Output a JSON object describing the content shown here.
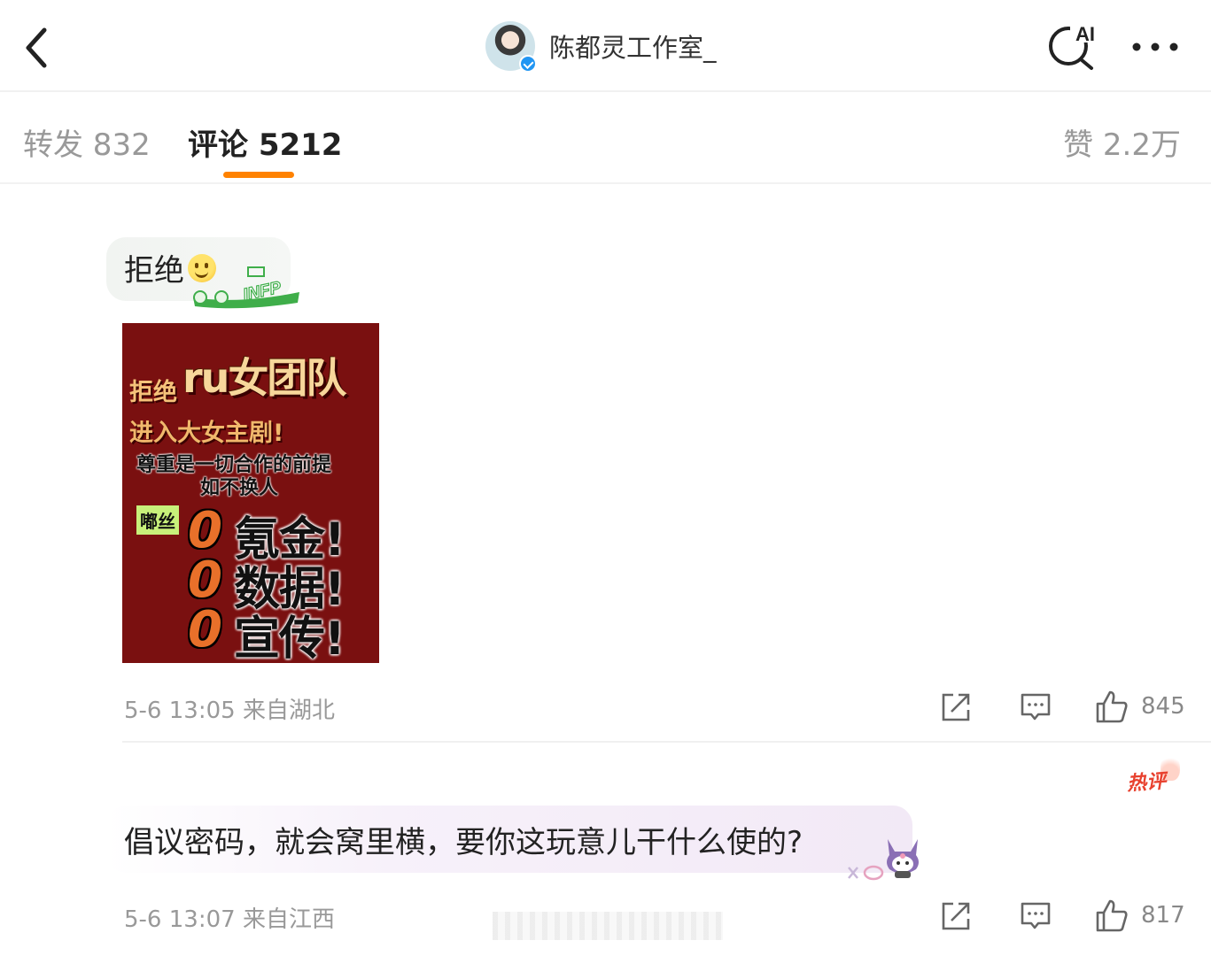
{
  "header": {
    "title": "陈都灵工作室_",
    "ai_label": "AI"
  },
  "tabs": {
    "repost": "转发 832",
    "comments": "评论 5212",
    "likes": "赞 2.2万"
  },
  "comments": [
    {
      "text": "拒绝",
      "badge": "INFP",
      "image": {
        "line_refuse": "拒绝",
        "line_group": "ru女团队",
        "line_enter": "进入大女主剧!",
        "line_respect": "尊重是一切合作的前提",
        "line_unless": "如不换人",
        "fans_label": "嘟丝",
        "zero": "0",
        "item1": "氪金!",
        "item2": "数据!",
        "item3": "宣传!"
      },
      "time": "5-6 13:05",
      "location": "来自湖北",
      "likes": "845"
    },
    {
      "hot_tag": "热评",
      "text": "倡议密码，就会窝里横，要你这玩意儿干什么使的?",
      "time": "5-6 13:07",
      "location": "来自江西",
      "likes": "817"
    }
  ],
  "colors": {
    "accent": "#ff8200",
    "hot": "#e8412e",
    "verify": "#2196f3",
    "poster_bg": "#7a1010"
  },
  "icons": [
    "back-arrow-icon",
    "verified-icon",
    "ai-search-icon",
    "more-icon",
    "share-icon",
    "comment-icon",
    "like-icon"
  ]
}
